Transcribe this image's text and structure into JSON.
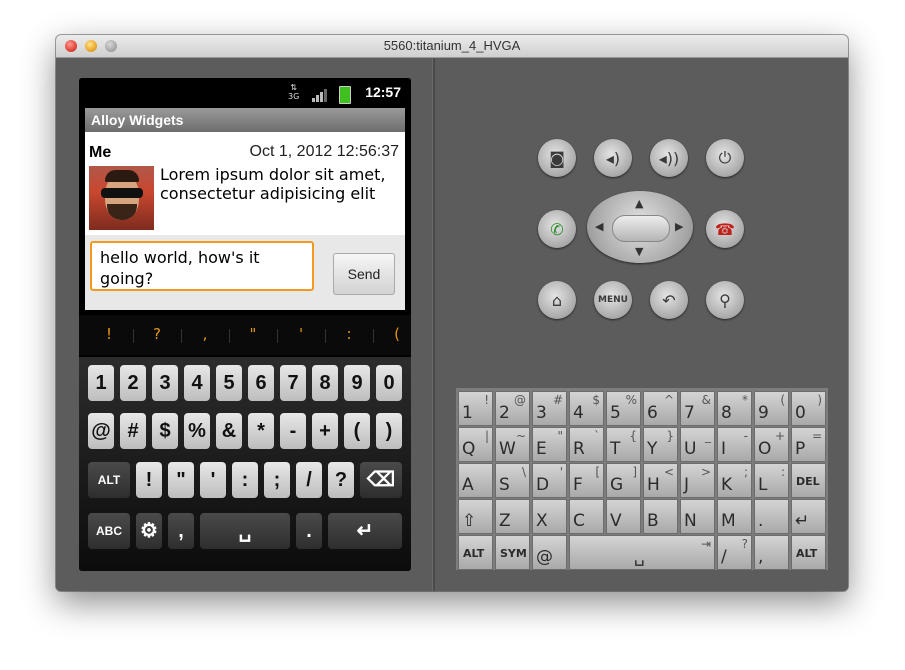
{
  "window": {
    "title": "5560:titanium_4_HVGA"
  },
  "status_bar": {
    "network": "3G",
    "time": "12:57"
  },
  "app": {
    "title": "Alloy Widgets"
  },
  "message": {
    "author": "Me",
    "date": "Oct 1, 2012 12:56:37",
    "text": "Lorem ipsum dolor sit amet, consectetur adipisicing elit"
  },
  "composer": {
    "input_value": "hello world, how's  it going?",
    "send_label": "Send"
  },
  "suggestions": [
    "!",
    "?",
    ",",
    "\"",
    "'",
    ":",
    "("
  ],
  "soft_keyboard": {
    "row1": [
      "1",
      "2",
      "3",
      "4",
      "5",
      "6",
      "7",
      "8",
      "9",
      "0"
    ],
    "row2": [
      "@",
      "#",
      "$",
      "%",
      "&",
      "*",
      "-",
      "+",
      "(",
      ")"
    ],
    "row3": [
      "ALT",
      "!",
      "\"",
      "'",
      ":",
      ";",
      "/",
      "?"
    ],
    "row4": [
      "ABC",
      ",",
      ".",
      "___"
    ]
  },
  "hardware_buttons": {
    "menu_label": "MENU"
  },
  "hardware_keyboard": {
    "row1": [
      [
        "1",
        "!"
      ],
      [
        "2",
        "@"
      ],
      [
        "3",
        "#"
      ],
      [
        "4",
        "$"
      ],
      [
        "5",
        "%"
      ],
      [
        "6",
        "^"
      ],
      [
        "7",
        "&"
      ],
      [
        "8",
        "*"
      ],
      [
        "9",
        "("
      ],
      [
        "0",
        ")"
      ]
    ],
    "row2": [
      [
        "Q",
        "|"
      ],
      [
        "W",
        "~"
      ],
      [
        "E",
        "\""
      ],
      [
        "R",
        "`"
      ],
      [
        "T",
        "{"
      ],
      [
        "Y",
        "}"
      ],
      [
        "U",
        "_"
      ],
      [
        "I",
        "-"
      ],
      [
        "O",
        "+"
      ],
      [
        "P",
        "="
      ]
    ],
    "row3": [
      [
        "A",
        ""
      ],
      [
        "S",
        "\\"
      ],
      [
        "D",
        "'"
      ],
      [
        "F",
        "["
      ],
      [
        "G",
        "]"
      ],
      [
        "H",
        "<"
      ],
      [
        "J",
        ">"
      ],
      [
        "K",
        ";"
      ],
      [
        "L",
        ":"
      ],
      [
        "DEL",
        ""
      ]
    ],
    "row4": [
      [
        "⇧",
        ""
      ],
      [
        "Z",
        ""
      ],
      [
        "X",
        ""
      ],
      [
        "C",
        ""
      ],
      [
        "V",
        ""
      ],
      [
        "B",
        ""
      ],
      [
        "N",
        ""
      ],
      [
        "M",
        ""
      ],
      [
        ".",
        ""
      ],
      [
        "↵",
        ""
      ]
    ],
    "row5": [
      [
        "ALT",
        ""
      ],
      [
        "SYM",
        ""
      ],
      [
        "@",
        ""
      ],
      [
        "",
        ""
      ],
      [
        "/",
        "?"
      ],
      [
        ",",
        ""
      ],
      [
        "ALT",
        ""
      ]
    ]
  }
}
